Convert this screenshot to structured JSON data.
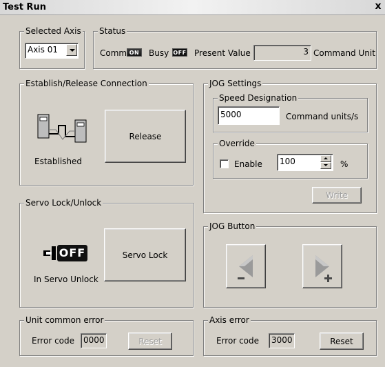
{
  "window": {
    "title": "Test Run",
    "close_glyph": "x"
  },
  "selected_axis": {
    "legend": "Selected Axis",
    "value": "Axis 01"
  },
  "status": {
    "legend": "Status",
    "comm_label": "Comm",
    "comm_lamp": "ON",
    "busy_label": "Busy",
    "busy_lamp": "OFF",
    "present_value_label": "Present Value",
    "present_value": "3",
    "unit": "Command Unit"
  },
  "connection": {
    "legend": "Establish/Release Connection",
    "state": "Established",
    "button": "Release",
    "icon": "network-connection-icon"
  },
  "jog_settings": {
    "legend": "JOG Settings",
    "speed": {
      "legend": "Speed Designation",
      "value": "5000",
      "unit": "Command units/s"
    },
    "override": {
      "legend": "Override",
      "enable_label": "Enable",
      "enabled": false,
      "value": "100",
      "unit": "%"
    },
    "write_button": "Write"
  },
  "servo": {
    "legend": "Servo Lock/Unlock",
    "icon_text": "OFF",
    "state": "In Servo Unlock",
    "button": "Servo Lock"
  },
  "jog_button": {
    "legend": "JOG Button",
    "reverse_icon": "jog-reverse-arrow-icon",
    "forward_icon": "jog-forward-arrow-icon"
  },
  "unit_error": {
    "legend": "Unit common error",
    "label": "Error code",
    "value": "0000",
    "button": "Reset"
  },
  "axis_error": {
    "legend": "Axis error",
    "label": "Error code",
    "value": "3000",
    "button": "Reset"
  }
}
